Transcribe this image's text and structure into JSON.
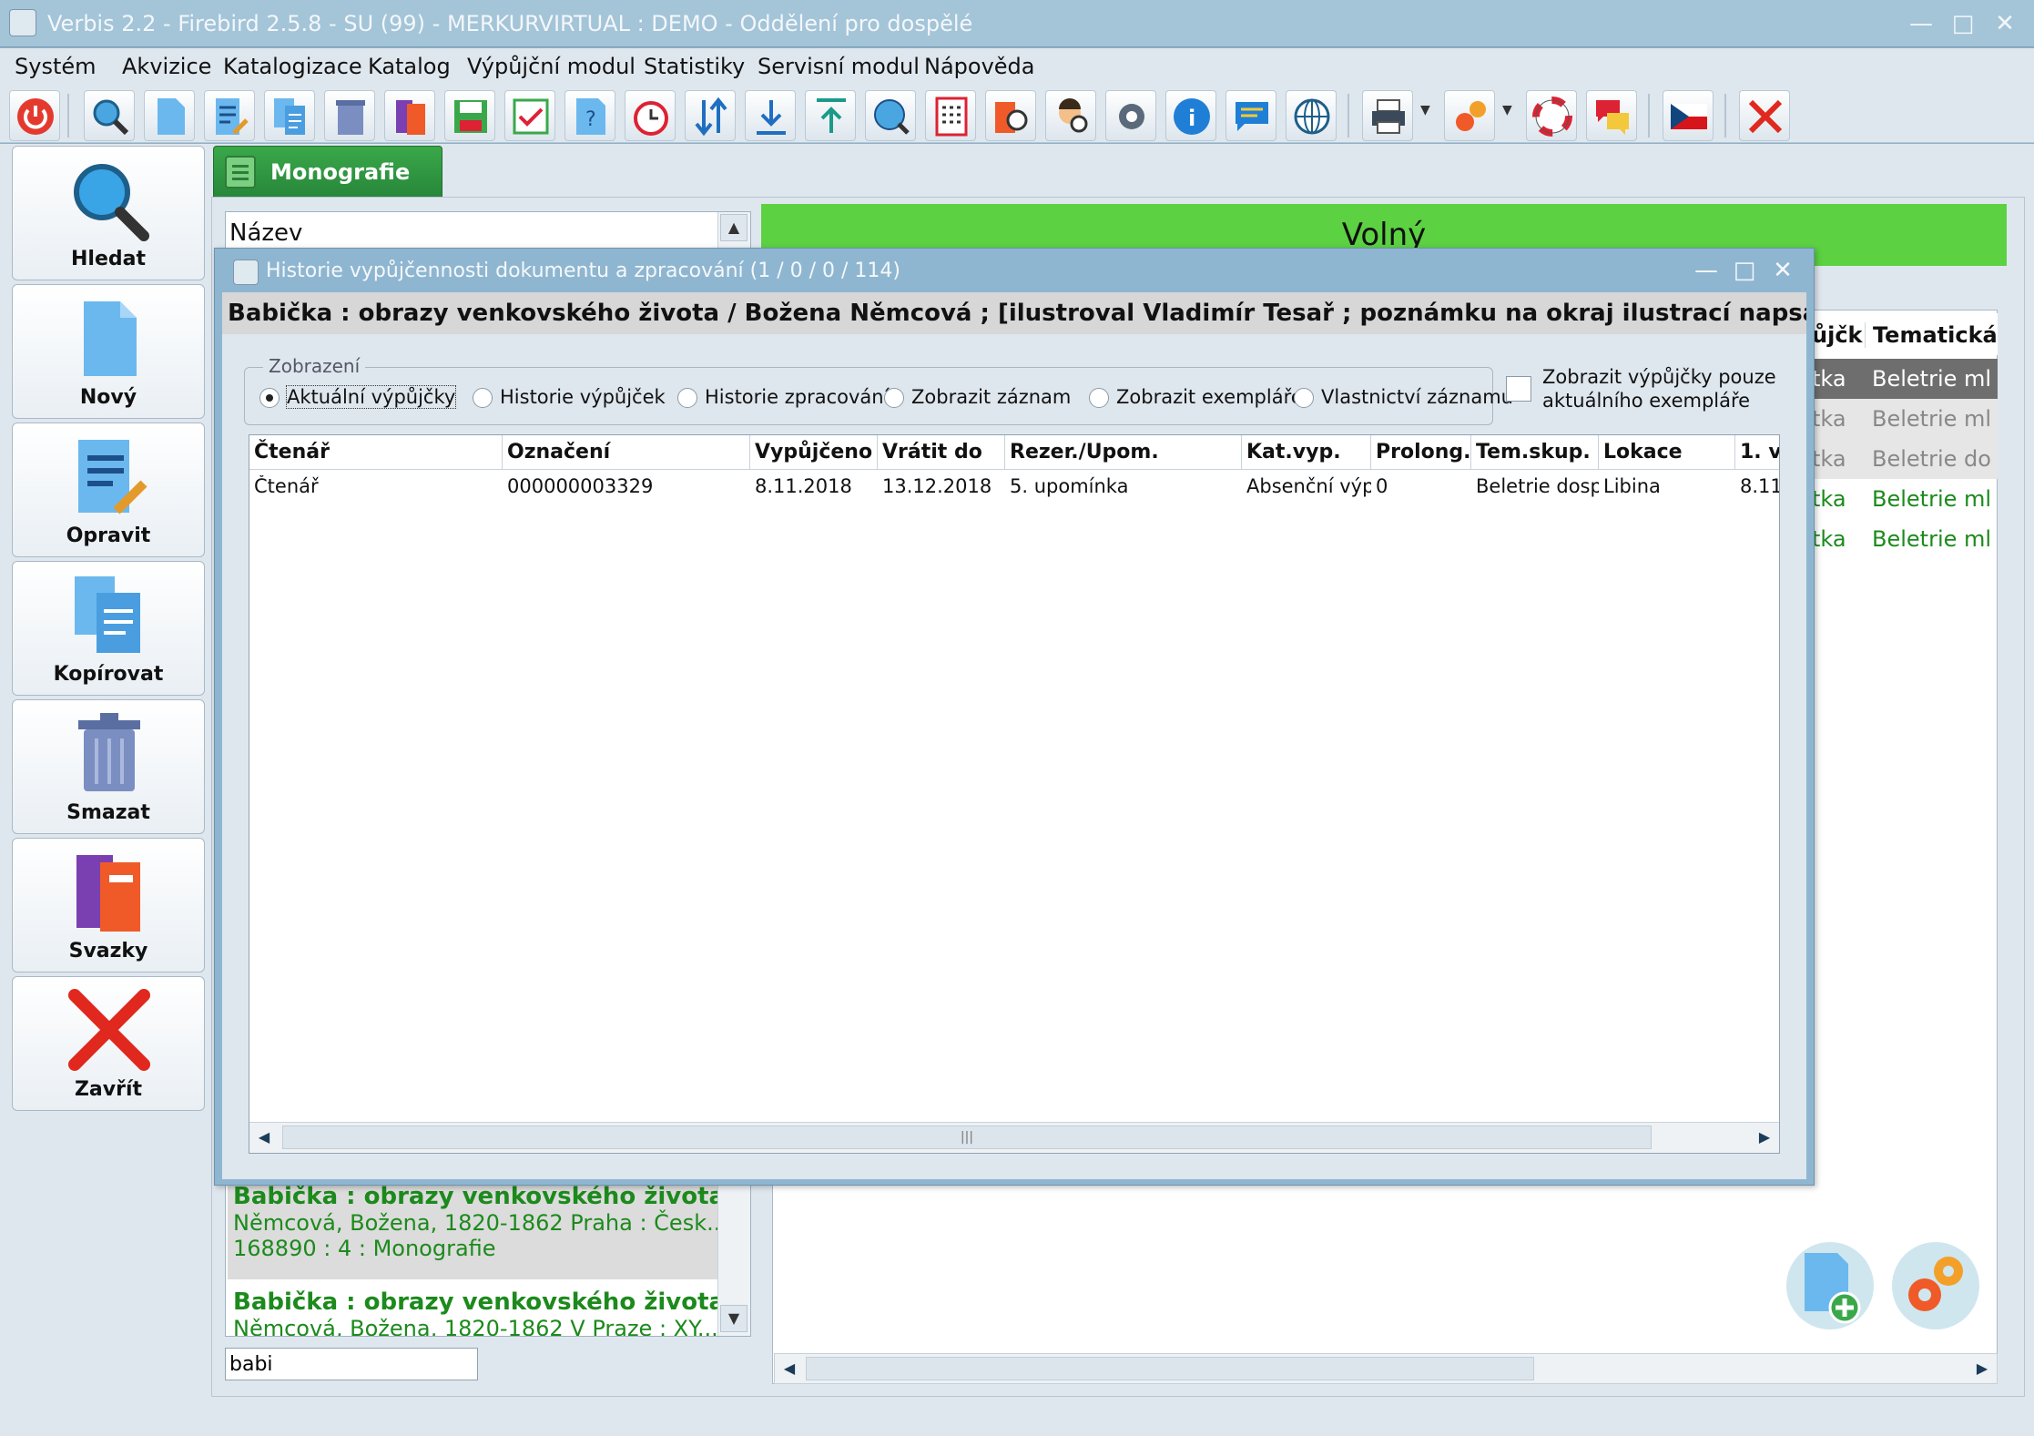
{
  "window": {
    "title": "Verbis 2.2 - Firebird 2.5.8 - SU (99) - MERKURVIRTUAL : DEMO - Oddělení pro dospělé",
    "controls": [
      "minimize-icon",
      "maximize-icon",
      "close-icon"
    ]
  },
  "menu": [
    "Systém",
    "Akvizice",
    "Katalogizace",
    "Katalog",
    "Výpůjční modul",
    "Statistiky",
    "Servisní modul",
    "Nápověda"
  ],
  "toolbar_icons": [
    "power-icon",
    "search-icon",
    "new-document-icon",
    "edit-icon",
    "copy-icon",
    "trash-icon",
    "books-icon",
    "save-icon",
    "checklist-icon",
    "help-document-icon",
    "alarm-clock-icon",
    "sort-arrows-icon",
    "download-icon",
    "upload-icon",
    "globe-search-icon",
    "calculator-icon",
    "book-search-icon",
    "user-search-icon",
    "settings-gear-icon",
    "info-icon",
    "comment-icon",
    "globe-icon",
    "printer-icon",
    "gears-icon",
    "lifebuoy-icon",
    "chat-icon",
    "czech-flag-icon",
    "close-red-icon"
  ],
  "sidebar": {
    "buttons": [
      {
        "label": "Hledat",
        "icon": "magnifier-icon"
      },
      {
        "label": "Nový",
        "icon": "new-page-icon"
      },
      {
        "label": "Opravit",
        "icon": "edit-document-icon"
      },
      {
        "label": "Kopírovat",
        "icon": "copy-documents-icon"
      },
      {
        "label": "Smazat",
        "icon": "trash-can-icon"
      },
      {
        "label": "Svazky",
        "icon": "books-stack-icon"
      },
      {
        "label": "Zavřít",
        "icon": "red-x-icon"
      }
    ]
  },
  "tab": {
    "label": "Monografie"
  },
  "list": {
    "header": "Název",
    "items": [
      {
        "line1": "Babička : obrazy venkovského života ...",
        "line2": "Němcová, Božena, 1820-1862 Praha : Česk...",
        "line3": "168890 : 4 : Monografie"
      },
      {
        "line1": "Babička : obrazy venkovského života ...",
        "line2": "Němcová, Božena, 1820-1862 V Praze : XY..."
      }
    ],
    "search_value": "babi"
  },
  "status_strip": {
    "text": "Volný",
    "color": "#5cd142"
  },
  "right_table": {
    "headers": [
      "ůjčk",
      "Tematická"
    ],
    "rows": [
      {
        "c1": "tka",
        "c2": "Beletrie mlá",
        "style": "dark"
      },
      {
        "c1": "tka",
        "c2": "Beletrie mlá",
        "style": "gray"
      },
      {
        "c1": "tka",
        "c2": "Beletrie dos",
        "style": "gray"
      },
      {
        "c1": "tka",
        "c2": "Beletrie mlá",
        "style": "green"
      },
      {
        "c1": "tka",
        "c2": "Beletrie mlá",
        "style": "green"
      }
    ]
  },
  "dialog": {
    "title": "Historie vypůjčennosti dokumentu a zpracování (1 / 0 / 0 / 114)",
    "doc_title": "Babička : obrazy venkovského života / Božena Němcová ; [ilustroval Vladimír Tesař ; poznámku na okraj ilustrací napsal Oldřich Hlavsa",
    "group_label": "Zobrazení",
    "radios": [
      {
        "label": "Aktuální výpůjčky",
        "checked": true
      },
      {
        "label": "Historie výpůjček",
        "checked": false
      },
      {
        "label": "Historie zpracování",
        "checked": false
      },
      {
        "label": "Zobrazit záznam",
        "checked": false
      },
      {
        "label": "Zobrazit exempláře",
        "checked": false
      },
      {
        "label": "Vlastnictví záznamu",
        "checked": false
      }
    ],
    "checkbox_label": "Zobrazit výpůjčky pouze aktuálního exempláře",
    "checkbox_checked": false,
    "columns": [
      "Čtenář",
      "Označení",
      "Vypůjčeno",
      "Vrátit do",
      "Rezer./Upom.",
      "Kat.vyp.",
      "Prolong.",
      "Tem.skup.",
      "Lokace",
      "1. v"
    ],
    "rows": [
      [
        "Čtenář",
        "000000003329",
        "8.11.2018",
        "13.12.2018",
        "5. upomínka",
        "Absenční výp",
        "0",
        "Beletrie dospě",
        "Libina",
        "8.11"
      ]
    ]
  },
  "colors": {
    "accent_green": "#2d8a3c",
    "link_green": "#1c8a1c",
    "window_frame": "#8fb6d0"
  }
}
